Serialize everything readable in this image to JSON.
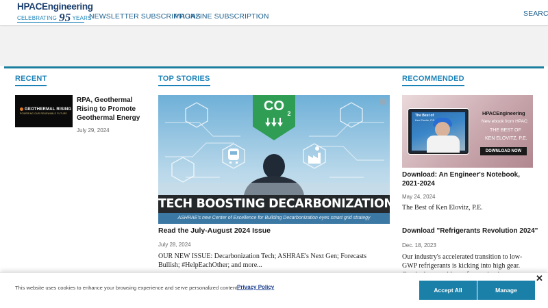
{
  "header": {
    "logo": {
      "line1": "HPACEngineering",
      "celebrating": "CELEBRATING",
      "number": "95",
      "years": "YEARS"
    },
    "nav": {
      "newsletter": "NEWSLETTER SUBSCRIPTIONS",
      "magazine": "MAGAZINE SUBSCRIPTION",
      "search": "SEARCH"
    }
  },
  "recent": {
    "heading": "RECENT",
    "thumb_title": "GEOTHERMAL RISING",
    "thumb_sub": "POWERING OUR RENEWABLE FUTURE",
    "title": "RPA, Geothermal Rising to Promote Geothermal Energy",
    "date": "July 29, 2024"
  },
  "top_stories": {
    "heading": "TOP STORIES",
    "image": {
      "co2": "CO",
      "co2_sub": "2",
      "banner": "TECH BOOSTING DECARBONIZATION",
      "caption": "ASHRAE's new Center of Excellence for Building Decarbonization eyes smart grid strategy"
    },
    "title": "Read the July-August 2024 Issue",
    "date": "July 28, 2024",
    "summary": "OUR NEW ISSUE: Decarbonization Tech; ASHRAE's Next Gen; Forecasts Bullish; #HelpEachOther; and more..."
  },
  "recommended": {
    "heading": "RECOMMENDED",
    "ad": {
      "photo_title": "The Best of",
      "photo_name": "Ken Elovitz, P.E.",
      "brand": "HPACEngineering",
      "line1": "New ebook from HPAC:",
      "line2": "THE BEST OF",
      "line3": "KEN ELOVITZ, P.E.",
      "button": "DOWNLOAD NOW"
    },
    "items": [
      {
        "title": "Download: An Engineer's Notebook, 2021-2024",
        "date": "May 24, 2024",
        "desc": "The Best of Ken Elovitz, P.E."
      },
      {
        "title": "Download \"Refrigerants Revolution 2024\"",
        "date": "Dec. 18, 2023",
        "desc": "Our industry's accelerated transition to low-GWP refrigerants is kicking into high gear. Get the latest guidance for staying in"
      }
    ]
  },
  "cookie": {
    "text": "This website uses cookies to enhance your browsing experience and serve personalized content.",
    "policy": "Privacy Policy",
    "accept": "Accept All",
    "manage": "Manage",
    "close": "✕"
  },
  "colors": {
    "brand_blue": "#1b82b8",
    "rule_teal": "#1a7f9d",
    "button_blue": "#1a80a8",
    "logo_navy": "#1b3f6f"
  }
}
